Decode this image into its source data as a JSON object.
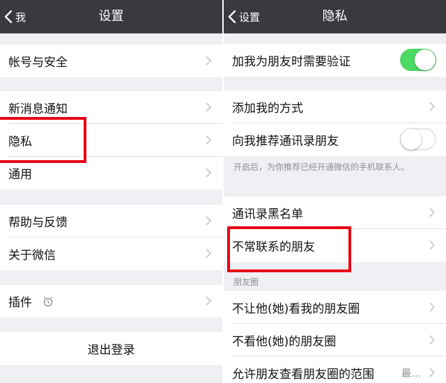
{
  "colors": {
    "navbar": "#393a3f",
    "accent_green": "#4cd964",
    "highlight_red": "#e60012",
    "background": "#efeff4"
  },
  "settings": {
    "back_label": "我",
    "title": "设置",
    "items": {
      "account_security": "帐号与安全",
      "new_message": "新消息通知",
      "privacy": "隐私",
      "general": "通用",
      "help_feedback": "帮助与反馈",
      "about": "关于微信",
      "plugins": "插件"
    },
    "logout": "退出登录"
  },
  "privacy": {
    "back_label": "设置",
    "title": "隐私",
    "verify_friend": {
      "label": "加我为朋友时需要验证",
      "enabled": true
    },
    "add_methods": "添加我的方式",
    "recommend_contacts": {
      "label": "向我推荐通讯录朋友",
      "enabled": false
    },
    "recommend_hint": "开启后，为你推荐已经开通微信的手机联系人。",
    "blacklist": "通讯录黑名单",
    "infrequent_friends": "不常联系的朋友",
    "moments_section": "朋友圈",
    "block_view": "不让他(她)看我的朋友圈",
    "hide_view": "不看他(她)的朋友圈",
    "moments_range": {
      "label": "允许朋友查看朋友圈的范围",
      "value": "最…"
    }
  }
}
